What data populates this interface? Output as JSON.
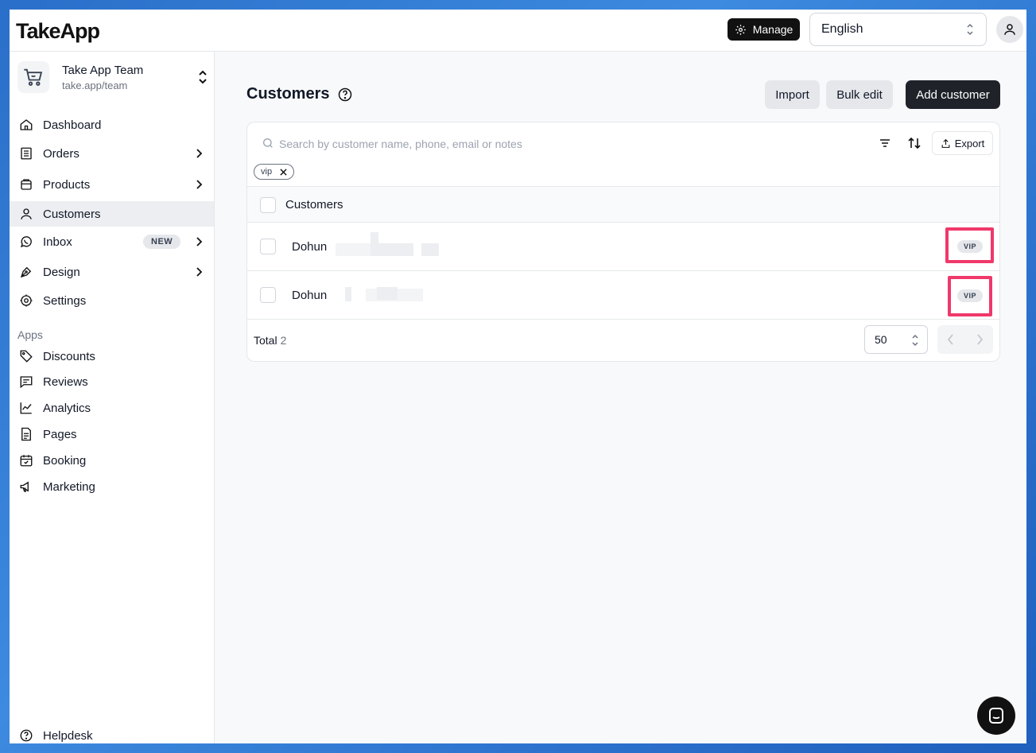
{
  "app": {
    "logo": "TakeApp"
  },
  "header": {
    "manage_label": "Manage",
    "language": "English"
  },
  "team": {
    "name": "Take App Team",
    "url": "take.app/team"
  },
  "nav": {
    "dashboard": "Dashboard",
    "orders": "Orders",
    "products": "Products",
    "customers": "Customers",
    "inbox": "Inbox",
    "inbox_badge": "NEW",
    "design": "Design",
    "settings": "Settings"
  },
  "apps": {
    "section_label": "Apps",
    "discounts": "Discounts",
    "reviews": "Reviews",
    "analytics": "Analytics",
    "pages": "Pages",
    "booking": "Booking",
    "marketing": "Marketing"
  },
  "helpdesk": "Helpdesk",
  "page": {
    "title": "Customers",
    "import_label": "Import",
    "bulk_edit_label": "Bulk edit",
    "add_customer_label": "Add customer"
  },
  "table": {
    "search_placeholder": "Search by customer name, phone, email or notes",
    "export_label": "Export",
    "filter_chip": "vip",
    "column_header": "Customers",
    "rows": [
      {
        "name": "Dohun",
        "tag": "VIP"
      },
      {
        "name": "Dohun",
        "tag": "VIP"
      }
    ],
    "total_label": "Total",
    "total_count": "2",
    "per_page": "50"
  },
  "colors": {
    "highlight": "#f0386b",
    "primary_dark": "#1f2329",
    "active_nav": "#eceef1"
  }
}
